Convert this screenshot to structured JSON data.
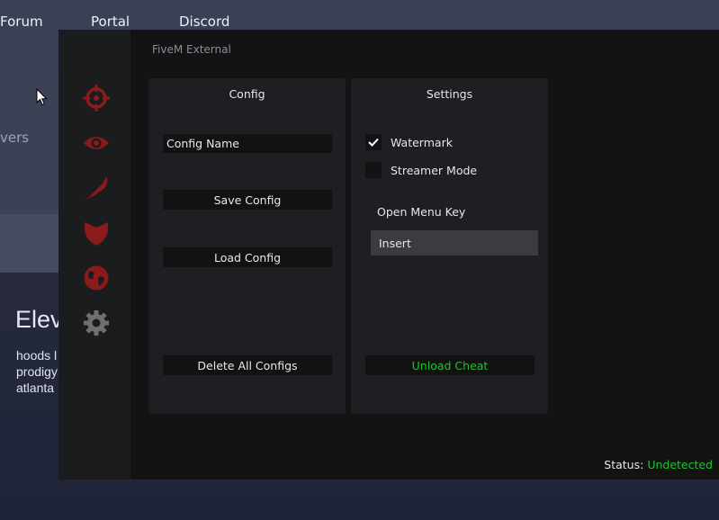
{
  "background_site": {
    "nav": [
      "Forum",
      "Portal",
      "Discord"
    ],
    "partial_text": "vers",
    "heading": "Elev",
    "paragraph": [
      "hoods l",
      "prodigy",
      "atlanta"
    ]
  },
  "window": {
    "title": "FiveM External",
    "sidebar": {
      "items": [
        {
          "name": "aimbot",
          "icon": "crosshair-icon",
          "color": "#8b1a1a"
        },
        {
          "name": "visuals",
          "icon": "eye-icon",
          "color": "#8b1a1a"
        },
        {
          "name": "misc",
          "icon": "feather-icon",
          "color": "#8b1a1a"
        },
        {
          "name": "protection",
          "icon": "shield-icon",
          "color": "#8b1a1a"
        },
        {
          "name": "world",
          "icon": "globe-icon",
          "color": "#8b1a1a"
        },
        {
          "name": "settings",
          "icon": "gear-icon",
          "color": "#6f6f72",
          "active": true
        }
      ]
    },
    "config_panel": {
      "title": "Config",
      "name_input_value": "Config Name",
      "save_label": "Save Config",
      "load_label": "Load Config",
      "delete_label": "Delete All Configs"
    },
    "settings_panel": {
      "title": "Settings",
      "watermark_label": "Watermark",
      "watermark_checked": true,
      "streamer_label": "Streamer Mode",
      "streamer_checked": false,
      "menu_key_label": "Open Menu Key",
      "menu_key_value": "Insert",
      "unload_label": "Unload Cheat"
    },
    "status": {
      "label": "Status:",
      "value": "Undetected",
      "value_color": "#22c12d"
    }
  }
}
